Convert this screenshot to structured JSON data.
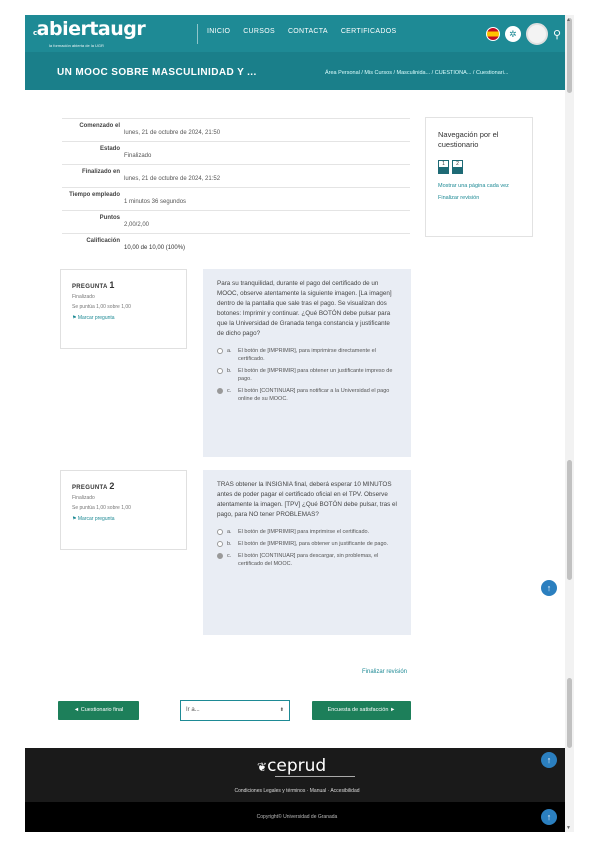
{
  "navbar": {
    "logo_text": "abiertaugr",
    "logo_prefix": "c",
    "logo_subtitle": "la formación abierta de la UGR",
    "links": [
      "INICIO",
      "CURSOS",
      "CONTACTA",
      "CERTIFICADOS"
    ],
    "lang_icon": "spain-flag-icon",
    "user_icon": "user-icon"
  },
  "course": {
    "title": "UN MOOC SOBRE MASCULINIDAD Y ...",
    "breadcrumb": "Área Personal / Mis Cursos / Masculinida... / CUESTIONA... / Cuestionari..."
  },
  "summary": [
    {
      "key": "Comenzado el",
      "value": "lunes, 21 de octubre de 2024, 21:50"
    },
    {
      "key": "Estado",
      "value": "Finalizado"
    },
    {
      "key": "Finalizado en",
      "value": "lunes, 21 de octubre de 2024, 21:52"
    },
    {
      "key": "Tiempo empleado",
      "value": "1 minutos 36 segundos"
    },
    {
      "key": "Puntos",
      "value": "2,00/2,00"
    },
    {
      "key": "Calificación",
      "value": "10,00 de 10,00 (100%)"
    }
  ],
  "quiz_nav": {
    "title": "Navegación por el cuestionario",
    "buttons": [
      "1",
      "2"
    ],
    "show_one_page": "Mostrar una página cada vez",
    "finish_review": "Finalizar revisión"
  },
  "questions": [
    {
      "label": "PREGUNTA",
      "number": "1",
      "status": "Finalizado",
      "score": "Se puntúa 1,00 sobre 1,00",
      "flag": "Marcar pregunta",
      "text": "Para su tranquilidad, durante el pago del certificado de un MOOC, observe atentamente la siguiente imagen. [La imagen] dentro de la pantalla que sale tras el pago. Se visualizan dos botones: Imprimir y continuar. ¿Qué BOTÓN debe pulsar para que la Universidad de Granada tenga constancia y justificante de dicho pago?",
      "options": [
        {
          "letter": "a.",
          "text": "El botón de [IMPRIMIR], para imprimirse directamente el certificado.",
          "checked": false
        },
        {
          "letter": "b.",
          "text": "El botón de [IMPRIMIR] para obtener un justificante impreso de pago.",
          "checked": false
        },
        {
          "letter": "c.",
          "text": "El botón [CONTINUAR] para notificar a la Universidad el pago online de su MOOC.",
          "checked": true
        }
      ]
    },
    {
      "label": "PREGUNTA",
      "number": "2",
      "status": "Finalizado",
      "score": "Se puntúa 1,00 sobre 1,00",
      "flag": "Marcar pregunta",
      "text": "TRAS obtener la INSIGNIA final, deberá esperar 10 MINUTOS antes de poder pagar el certificado oficial en el TPV. Observe atentamente la imagen. [TPV] ¿Qué BOTÓN debe pulsar, tras el pago, para NO tener PROBLEMAS?",
      "options": [
        {
          "letter": "a.",
          "text": "El botón de [IMPRIMIR] para imprimirse el certificado.",
          "checked": false
        },
        {
          "letter": "b.",
          "text": "El botón de [IMPRIMIR], para obtener un justificante de pago.",
          "checked": false
        },
        {
          "letter": "c.",
          "text": "El botón [CONTINUAR] para descargar, sin problemas, el certificado del MOOC.",
          "checked": true
        }
      ]
    }
  ],
  "finish_review": "Finalizar revisión",
  "bottom_nav": {
    "prev": "◄ Cuestionario final",
    "jump": "Ir a...",
    "next": "Encuesta de satisfacción ►"
  },
  "footer": {
    "logo": "ceprud",
    "links": "Condiciones Legales y términos · Manual · Accesibilidad",
    "copyright": "Copyright© Universidad de Granada"
  },
  "totop_icon": "arrow-up-icon"
}
